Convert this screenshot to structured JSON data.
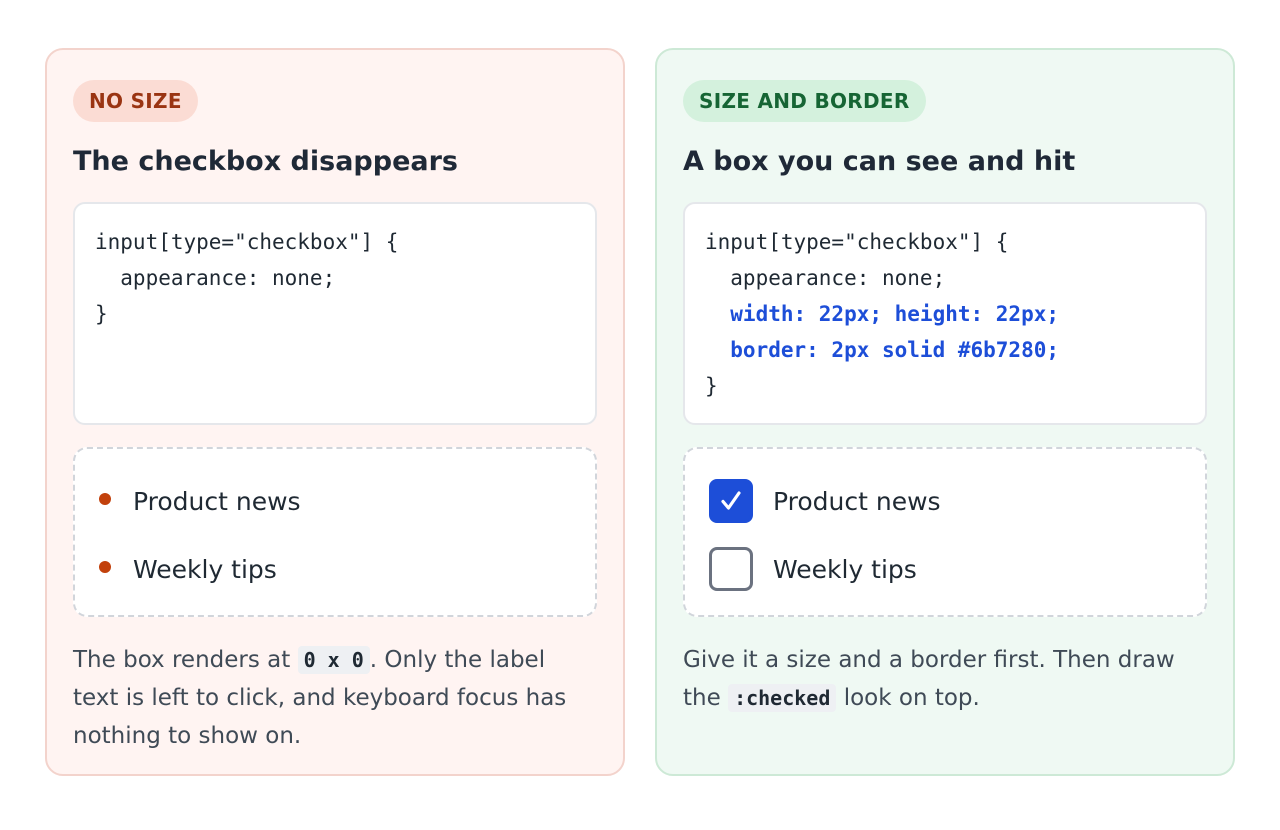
{
  "left": {
    "badge": "NO SIZE",
    "title": "The checkbox disappears",
    "code": {
      "line1": "input[type=\"checkbox\"] {",
      "line2": "  appearance: none;",
      "line3": "}"
    },
    "items": [
      "Product news",
      "Weekly tips"
    ],
    "note": {
      "part1": "The box renders at ",
      "code": "0 x 0",
      "part2": ". Only the label text is left to click, and keyboard focus has nothing to show on."
    },
    "colors": {
      "accent": "#c2410c",
      "badge_bg": "#fbdcd4",
      "panel_bg": "#fff4f2"
    }
  },
  "right": {
    "badge": "SIZE AND BORDER",
    "title": "A box you can see and hit",
    "code": {
      "line1": "input[type=\"checkbox\"] {",
      "line2": "  appearance: none;",
      "line3": "  width: 22px; height: 22px;",
      "line4": "  border: 2px solid #6b7280;",
      "line5": "}"
    },
    "items": [
      {
        "label": "Product news",
        "checked": true
      },
      {
        "label": "Weekly tips",
        "checked": false
      }
    ],
    "note": {
      "part1": "Give it a size and a border first. Then draw the ",
      "code": ":checked",
      "part2": " look on top."
    },
    "colors": {
      "accent": "#1d4ed8",
      "border": "#6b7280",
      "badge_bg": "#d4f1dd",
      "panel_bg": "#eff9f3"
    }
  }
}
